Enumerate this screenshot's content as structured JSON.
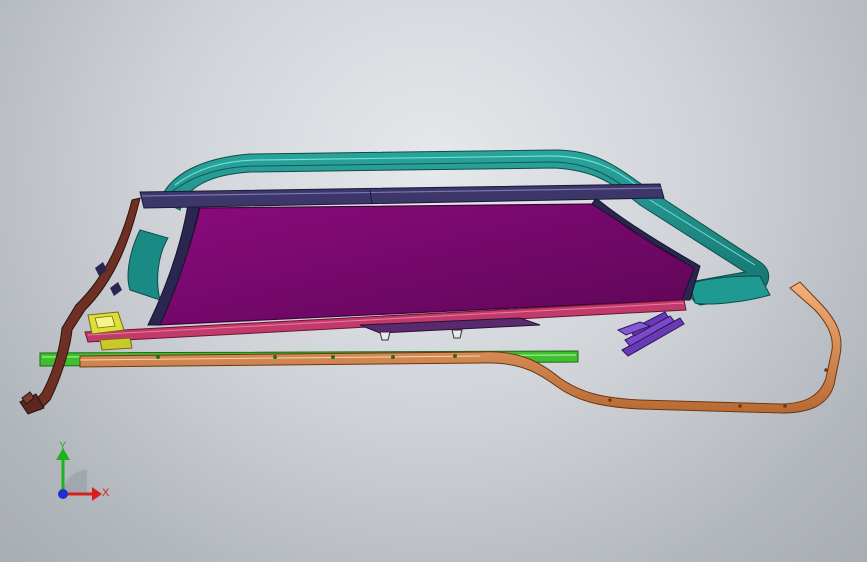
{
  "viewport": {
    "background_top": "#e6e8eb",
    "background_bottom": "#a8adb3"
  },
  "model": {
    "parts": [
      {
        "name": "glass-panel",
        "color": "#7a0a6e"
      },
      {
        "name": "upper-header-rail",
        "color": "#3c3768"
      },
      {
        "name": "drain-trough-frame",
        "color": "#1f8c86"
      },
      {
        "name": "front-rail",
        "color": "#6e2f24"
      },
      {
        "name": "lower-seal-rail",
        "color": "#c23a6a"
      },
      {
        "name": "guide-rail-green",
        "color": "#3fbf2f"
      },
      {
        "name": "cable-drive",
        "color": "#d98a4c"
      },
      {
        "name": "motor-bracket",
        "color": "#dede3a"
      },
      {
        "name": "rear-deflector-blades",
        "color": "#6a3ab5"
      }
    ]
  },
  "triad": {
    "y_label": "Y",
    "x_label": "X",
    "y_color": "#1fb21f",
    "x_color": "#d62020",
    "z_color": "#2030d0"
  }
}
